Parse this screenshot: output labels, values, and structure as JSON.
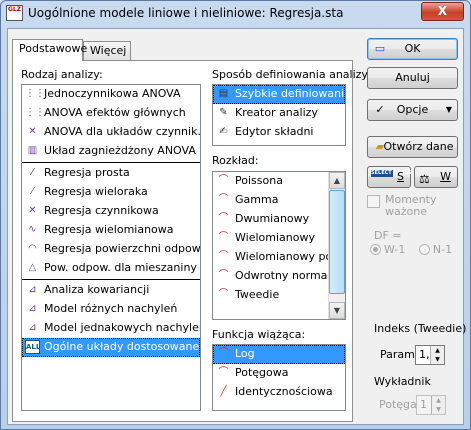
{
  "window": {
    "title": "Uogólnione modele liniowe i nieliniowe: Regresja.sta",
    "app_icon_text": "GLZ",
    "close_label": "X"
  },
  "tabs": [
    {
      "label": "Podstawowe",
      "active": true
    },
    {
      "label": "Więcej",
      "active": false
    }
  ],
  "analysis": {
    "label": "Rodzaj analizy:",
    "groups": [
      [
        {
          "label": "Jednoczynnikowa ANOVA",
          "icon": "one-way-anova-icon",
          "glyph": "⋮⋮"
        },
        {
          "label": "ANOVA efektów głównych",
          "icon": "main-effects-anova-icon",
          "glyph": "⋮⋮"
        },
        {
          "label": "ANOVA dla układów czynnik.",
          "icon": "factorial-anova-icon",
          "glyph": "✕"
        },
        {
          "label": "Układ zagnieżdżony ANOVA",
          "icon": "nested-anova-icon",
          "glyph": "▥"
        }
      ],
      [
        {
          "label": "Regresja prosta",
          "icon": "simple-regression-icon",
          "glyph": "⁄"
        },
        {
          "label": "Regresja wieloraka",
          "icon": "multiple-regression-icon",
          "glyph": "⁄"
        },
        {
          "label": "Regresja czynnikowa",
          "icon": "factorial-regression-icon",
          "glyph": "✕"
        },
        {
          "label": "Regresja wielomianowa",
          "icon": "polynomial-regression-icon",
          "glyph": "∿"
        },
        {
          "label": "Regresja powierzchni odpow.",
          "icon": "response-surface-regression-icon",
          "glyph": "◠"
        },
        {
          "label": "Pow. odpow. dla mieszaniny",
          "icon": "mixture-surface-icon",
          "glyph": "△"
        }
      ],
      [
        {
          "label": "Analiza kowariancji",
          "icon": "ancova-icon",
          "glyph": "⊿"
        },
        {
          "label": "Model różnych nachyleń",
          "icon": "separate-slopes-icon",
          "glyph": "⊿"
        },
        {
          "label": "Model jednakowych nachyleń",
          "icon": "homogeneity-slopes-icon",
          "glyph": "⊿"
        },
        {
          "label": "Ogólne układy dostosowane",
          "icon": "custom-design-icon",
          "glyph": "ALL",
          "selected": true
        }
      ]
    ]
  },
  "specification": {
    "label": "Sposób definiowania analizy:",
    "items": [
      {
        "label": "Szybkie definiowanie",
        "icon": "quick-specs-icon",
        "glyph": "▤",
        "selected": true
      },
      {
        "label": "Kreator analizy",
        "icon": "wizard-icon",
        "glyph": "✎"
      },
      {
        "label": "Edytor składni",
        "icon": "syntax-editor-icon",
        "glyph": "✍"
      }
    ]
  },
  "distribution": {
    "label": "Rozkład:",
    "items": [
      {
        "label": "Poissona",
        "glyph": "⌒"
      },
      {
        "label": "Gamma",
        "glyph": "⌒"
      },
      {
        "label": "Dwumianowy",
        "glyph": "⌒"
      },
      {
        "label": "Wielomianowy",
        "glyph": "⌒"
      },
      {
        "label": "Wielomianowy porz",
        "glyph": "⌒"
      },
      {
        "label": "Odwrotny normalny",
        "glyph": "⌒"
      },
      {
        "label": "Tweedie",
        "glyph": "⌒"
      }
    ]
  },
  "link_function": {
    "label": "Funkcja wiążąca:",
    "items": [
      {
        "label": "Log",
        "glyph": "⌒",
        "selected": true
      },
      {
        "label": "Potęgowa",
        "glyph": "⌒"
      },
      {
        "label": "Identycznościowa",
        "glyph": "╱"
      }
    ]
  },
  "buttons": {
    "ok": "OK",
    "cancel": "Anuluj",
    "options": "Opcje",
    "open_data": "Otwórz dane",
    "select_cases": "SELECT CASES",
    "select_cases_shortcut": "S",
    "weights_shortcut": "W"
  },
  "moments": {
    "label": "Momenty ważone",
    "checked": false
  },
  "df": {
    "label": "DF =",
    "options": [
      {
        "label": "W-1",
        "selected": true
      },
      {
        "label": "N-1",
        "selected": false
      }
    ]
  },
  "tweedie_index": {
    "group_label": "Indeks (Tweedie)",
    "param_label": "Param:",
    "value": "1,5"
  },
  "exponent": {
    "group_label": "Wykładnik",
    "power_label": "Potęga:",
    "value": "1"
  }
}
